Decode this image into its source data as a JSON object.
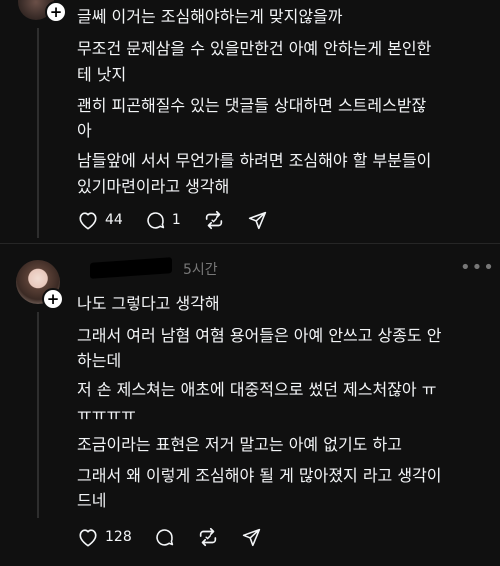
{
  "post1": {
    "lines": [
      "글쎄 이거는 조심해야하는게 맞지않을까",
      "무조건 문제삼을 수 있을만한건 아예 안하는게 본인한",
      "테 낫지",
      "괜히 피곤해질수 있는 댓글들 상대하면 스트레스받잖",
      "아",
      "남들앞에 서서 무언가를 하려면 조심해야 할 부분들이",
      "있기마련이라고 생각해"
    ],
    "likes": "44",
    "replies": "1"
  },
  "post2": {
    "time": "5시간",
    "more": "•••",
    "lines": [
      "나도 그렇다고 생각해",
      "그래서 여러 남혐 여혐 용어들은 아예 안쓰고 상종도 안",
      "하는데",
      "저 손 제스쳐는 애초에 대중적으로 썼던 제스처잖아 ㅠ",
      "ㅠㅠㅠㅠ",
      "조금이라는 표현은 저거 말고는 아예 없기도 하고",
      "그래서 왜 이렇게 조심해야 될 게 많아졌지 라고 생각이",
      "드네"
    ],
    "likes": "128"
  },
  "icons": {
    "plus": "+",
    "like": "heart-icon",
    "reply": "comment-icon",
    "repost": "repost-icon",
    "share": "send-icon"
  }
}
